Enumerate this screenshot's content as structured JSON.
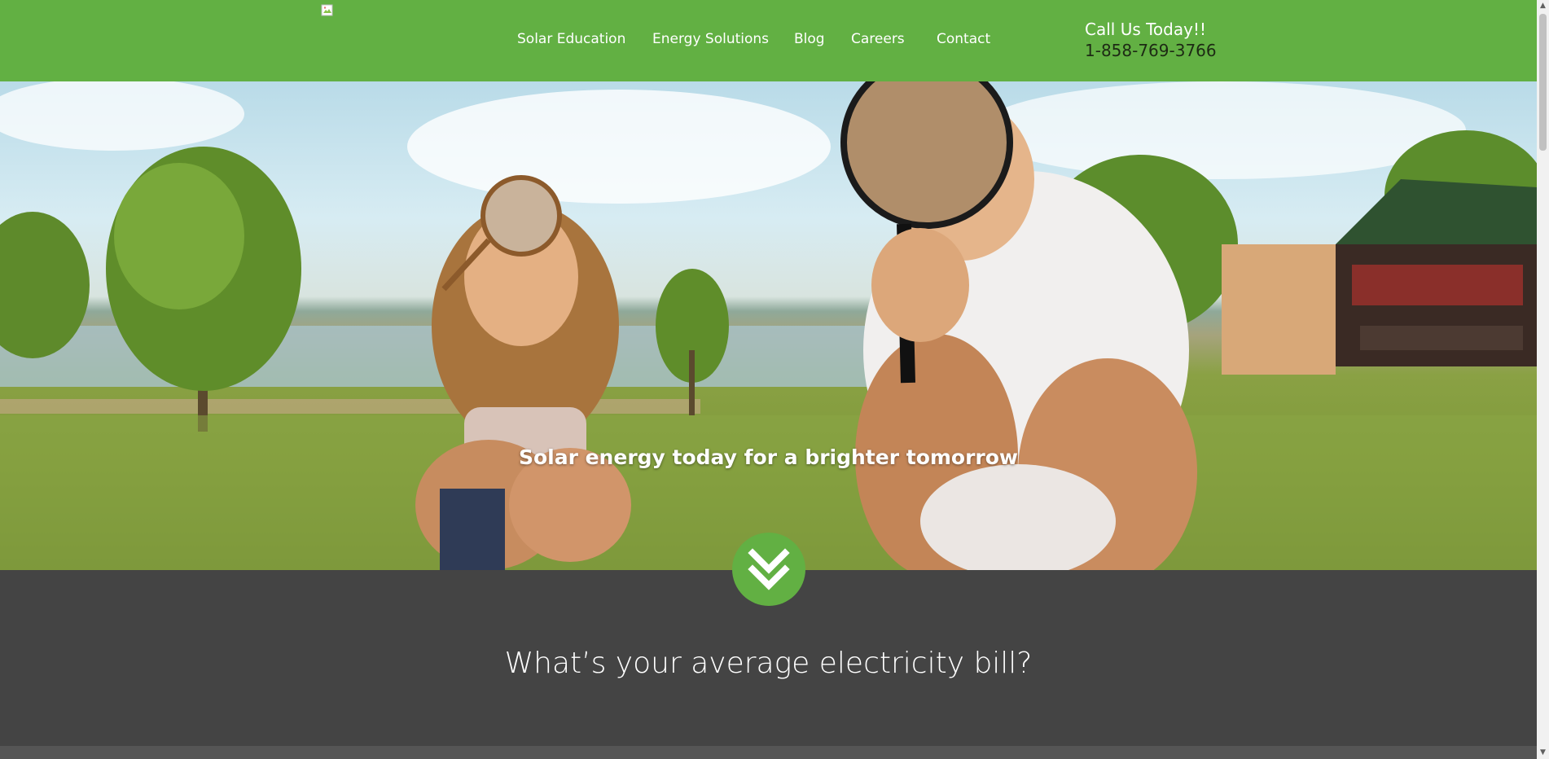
{
  "header": {
    "logo_alt": "",
    "nav": [
      {
        "label": "Solar Education"
      },
      {
        "label": "Energy Solutions"
      },
      {
        "label": "Blog"
      },
      {
        "label": "Careers"
      },
      {
        "label": "Contact"
      }
    ],
    "call_label": "Call Us Today!!",
    "phone": "1-858-769-3766"
  },
  "hero": {
    "caption": "Solar energy today for a brighter tomorrow",
    "image_icon": "photo-children-magnifying-glasses"
  },
  "section": {
    "title": "What’s your average electricity bill?"
  },
  "colors": {
    "brand_green": "#62b043",
    "dark_section": "#444444"
  },
  "icons": {
    "down_button": "double-chevron-down-icon",
    "scroll_up": "▲",
    "scroll_down": "▼"
  }
}
